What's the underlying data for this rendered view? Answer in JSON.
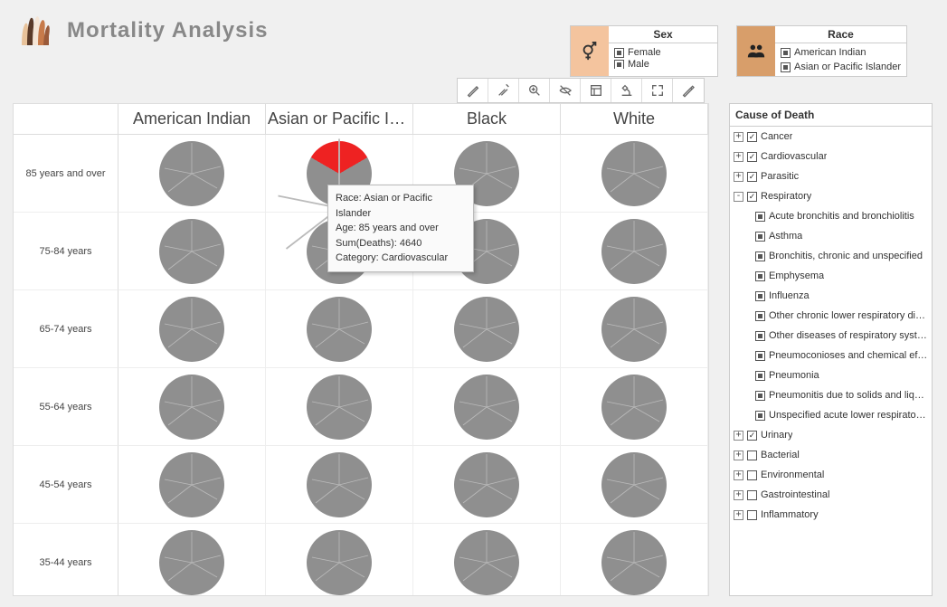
{
  "title": "Mortality Analysis",
  "filters": {
    "sex": {
      "title": "Sex",
      "items": [
        "Female",
        "Male"
      ]
    },
    "race": {
      "title": "Race",
      "items": [
        "American Indian",
        "Asian or Pacific Islander"
      ]
    }
  },
  "toolbar": {
    "tools": [
      "highlight",
      "brush",
      "zoom",
      "hide",
      "dock",
      "microscope",
      "expand",
      "edit"
    ]
  },
  "grid": {
    "columns": [
      "American Indian",
      "Asian or Pacific Islan..",
      "Black",
      "White"
    ],
    "rows": [
      "85 years and over",
      "75-84 years",
      "65-74 years",
      "55-64 years",
      "45-54 years",
      "35-44 years"
    ]
  },
  "tooltip": {
    "l1": "Race: Asian or Pacific Islander",
    "l2": "Age: 85 years and over",
    "l3": "Sum(Deaths): 4640",
    "l4": "Category: Cardiovascular"
  },
  "tree": {
    "title": "Cause of Death",
    "top": [
      {
        "label": "Cancer",
        "exp": "+",
        "checked": true
      },
      {
        "label": "Cardiovascular",
        "exp": "+",
        "checked": true
      },
      {
        "label": "Parasitic",
        "exp": "+",
        "checked": true
      }
    ],
    "resp": {
      "label": "Respiratory",
      "exp": "-",
      "checked": true
    },
    "resp_children": [
      "Acute bronchitis and bronchiolitis",
      "Asthma",
      "Bronchitis, chronic and unspecified",
      "Emphysema",
      "Influenza",
      "Other chronic lower respiratory diseases",
      "Other diseases of respiratory system",
      "Pneumoconioses and chemical effects",
      "Pneumonia",
      "Pneumonitis due to solids and liquids",
      "Unspecified acute lower respiratory infection"
    ],
    "bottom": [
      {
        "label": "Urinary",
        "exp": "+",
        "checked": true
      },
      {
        "label": "Bacterial",
        "exp": "+",
        "checked": false
      },
      {
        "label": "Environmental",
        "exp": "+",
        "checked": false
      },
      {
        "label": "Gastrointestinal",
        "exp": "+",
        "checked": false
      },
      {
        "label": "Inflammatory",
        "exp": "+",
        "checked": false
      }
    ]
  },
  "chart_data": {
    "type": "pie",
    "layout": "trellis",
    "row_dimension": "Age",
    "column_dimension": "Race",
    "measure": "Sum(Deaths)",
    "color_dimension": "Category",
    "highlighted_slice": {
      "row": "85 years and over",
      "column": "Asian or Pacific Islander",
      "category": "Cardiovascular",
      "value": 4640,
      "approx_share": 0.33
    }
  }
}
